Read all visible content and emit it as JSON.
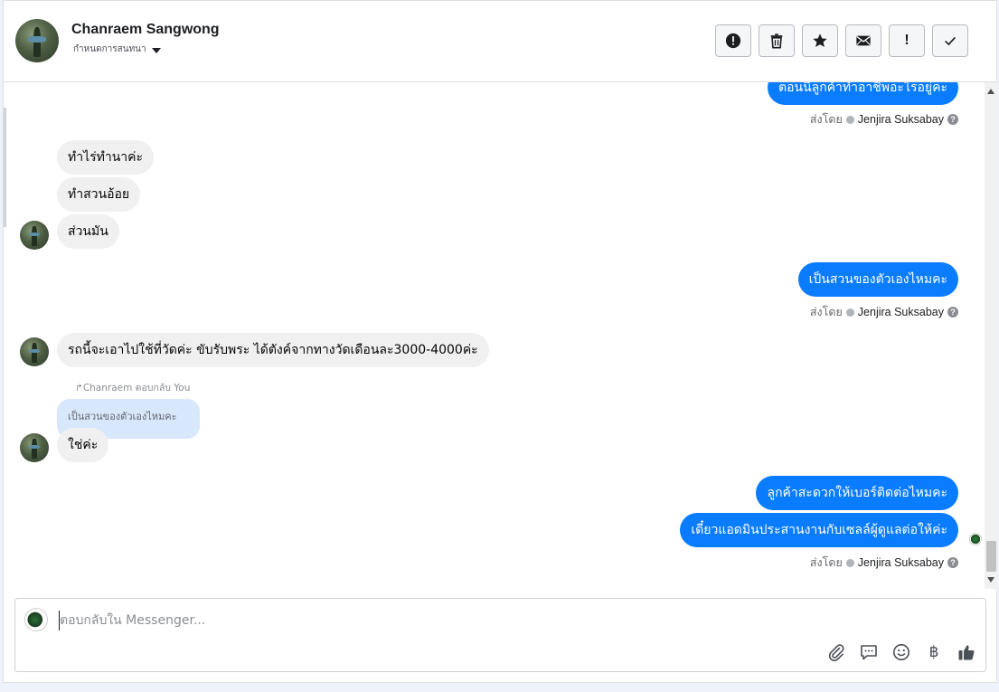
{
  "header": {
    "contact_name": "Chanraem Sangwong",
    "assign_label": "กำหนดการสนทนา",
    "actions": [
      {
        "icon": "alert-circle-icon"
      },
      {
        "icon": "trash-icon"
      },
      {
        "icon": "star-icon"
      },
      {
        "icon": "envelope-icon"
      },
      {
        "icon": "exclamation-icon",
        "label": "!"
      },
      {
        "icon": "check-icon"
      }
    ]
  },
  "messages": {
    "m0": "ตอนนี้ลูกค้าทำอาชีพอะไรอยู่คะ",
    "m1": "ทำไร่ทำนาค่ะ",
    "m2": "ทำสวนอ้อย",
    "m3": "ส่วนมัน",
    "m4": "เป็นสวนของตัวเองไหมคะ",
    "m5": "รถนี้จะเอาไปใช้ที่วัดค่ะ ขับรับพระ ได้ตังค์จากทางวัดเดือนละ3000-4000ค่ะ",
    "reply_note": "Chanraem ตอบกลับ You",
    "quoted": "เป็นสวนของตัวเองไหมคะ",
    "m6": "ใช่ค่ะ",
    "m7": "ลูกค้าสะดวกให้เบอร์ติดต่อไหมคะ",
    "m8": "เดี๋ยวแอดมินประสานงานกับเซลล์ผู้ดูแลต่อให้ค่ะ"
  },
  "sent_by": {
    "prefix": "ส่งโดย",
    "agent": "Jenjira Suksabay",
    "help": "?"
  },
  "composer": {
    "placeholder": "ตอบกลับใน Messenger...",
    "tools": [
      "paperclip-icon",
      "saved-reply-icon",
      "emoji-icon",
      "baht-icon",
      "thumbs-up-icon"
    ],
    "baht_symbol": "฿"
  },
  "colors": {
    "outgoing_bubble": "#0a7cff",
    "incoming_bubble": "#f0f0f0",
    "quoted_bubble": "#d7e7fc"
  }
}
